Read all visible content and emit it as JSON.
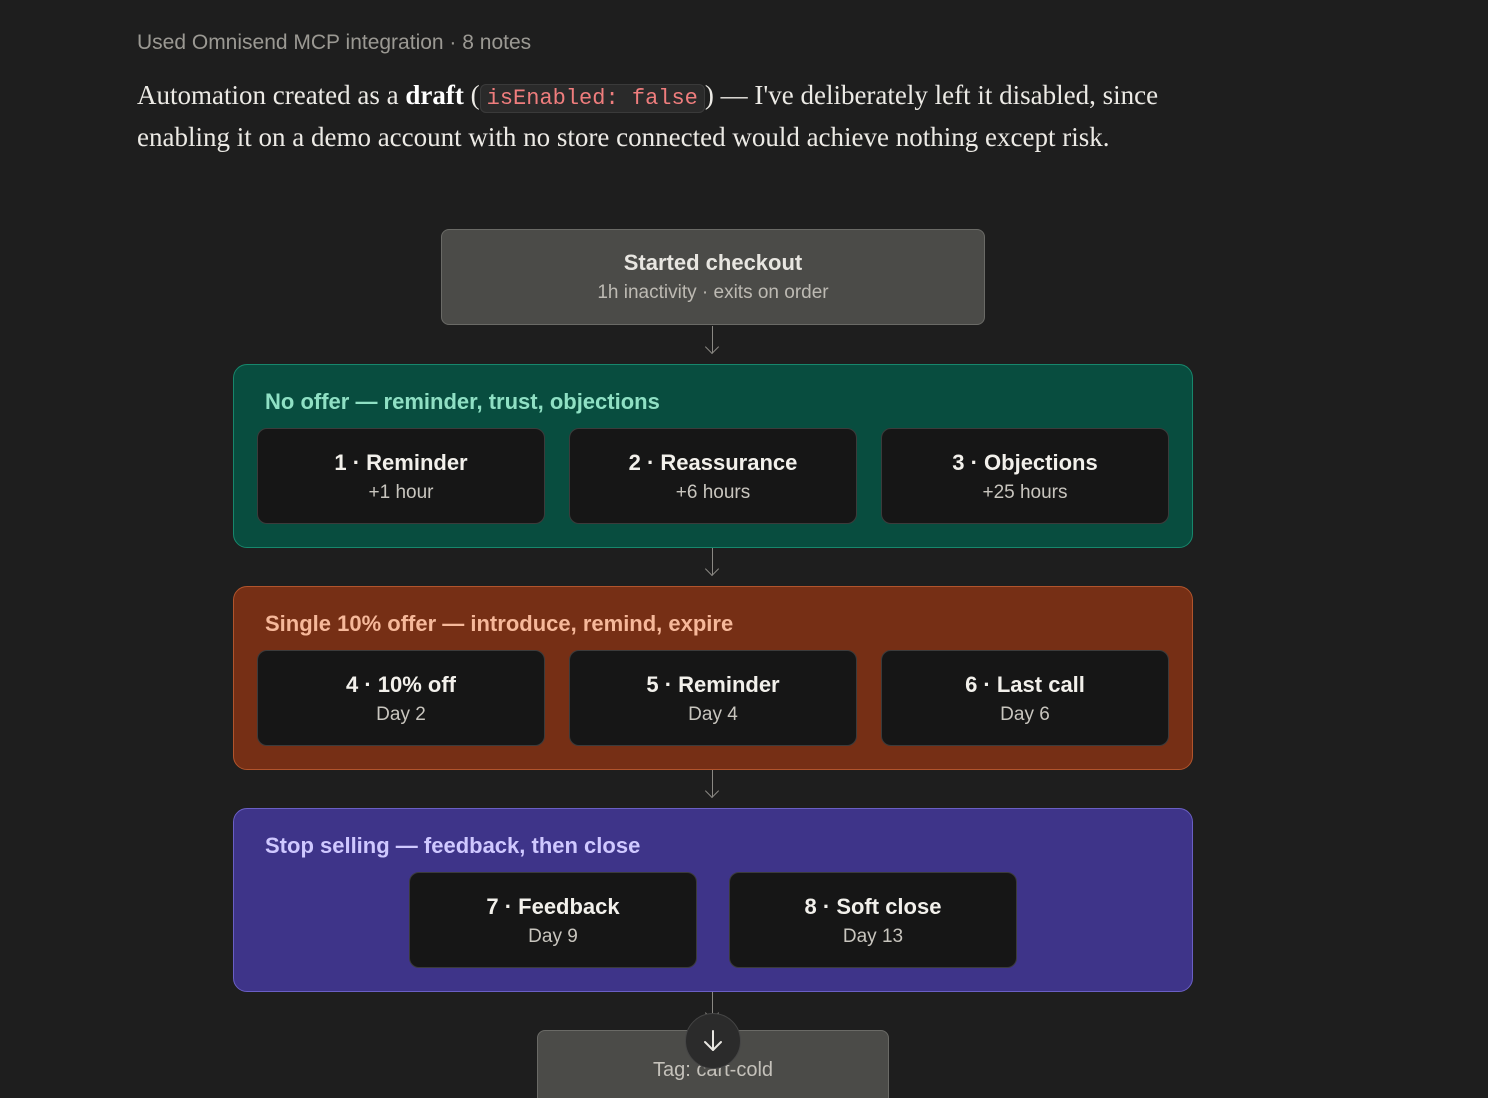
{
  "message": {
    "tool_note": "Used Omnisend MCP integration · 8 notes",
    "para_before": "Automation created as a ",
    "para_bold": "draft",
    "para_open": " (",
    "para_code": "isEnabled: false",
    "para_close": ")",
    "para_after": " — I've deliberately left it disabled, since enabling it on a demo account with no store connected would achieve nothing except risk."
  },
  "flow": {
    "trigger": {
      "title": "Started checkout",
      "subtitle": "1h inactivity · exits on order"
    },
    "groups": [
      {
        "title": "No offer — reminder, trust, objections",
        "steps": [
          {
            "title": "1 · Reminder",
            "subtitle": "+1 hour"
          },
          {
            "title": "2 · Reassurance",
            "subtitle": "+6 hours"
          },
          {
            "title": "3 · Objections",
            "subtitle": "+25 hours"
          }
        ]
      },
      {
        "title": "Single 10% offer — introduce, remind, expire",
        "steps": [
          {
            "title": "4 · 10% off",
            "subtitle": "Day 2"
          },
          {
            "title": "5 · Reminder",
            "subtitle": "Day 4"
          },
          {
            "title": "6 · Last call",
            "subtitle": "Day 6"
          }
        ]
      },
      {
        "title": "Stop selling — feedback, then close",
        "steps": [
          {
            "title": "7 · Feedback",
            "subtitle": "Day 9"
          },
          {
            "title": "8 · Soft close",
            "subtitle": "Day 13"
          }
        ]
      }
    ],
    "end": {
      "label": "Tag: cart-cold"
    }
  },
  "colors": {
    "group_no_offer": "#084d3f",
    "group_offer": "#762f15",
    "group_stop": "#3e3489",
    "code_text": "#ef7d7d"
  },
  "icons": {
    "scroll_button": "arrow-down-icon"
  }
}
